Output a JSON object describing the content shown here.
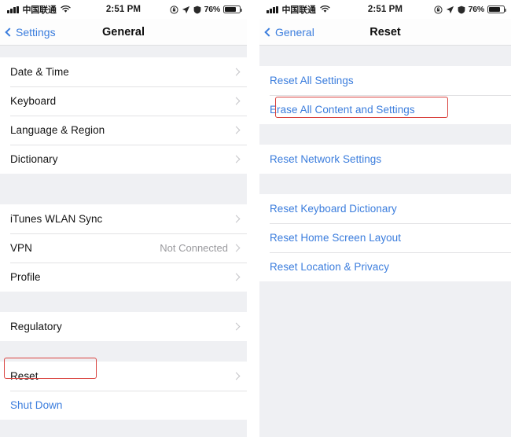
{
  "status_bar": {
    "carrier": "中国联通",
    "time": "2:51 PM",
    "battery_percent": "76%",
    "signal_icon": "cellular-bars-icon",
    "wifi_icon": "wifi-icon",
    "rotation_lock_icon": "rotation-lock-icon",
    "location_icon": "location-arrow-icon",
    "dnd_icon": "do-not-disturb-icon",
    "battery_icon": "battery-icon"
  },
  "left_screen": {
    "back_label": "Settings",
    "title": "General",
    "sections": [
      {
        "rows": [
          {
            "label": "Date & Time",
            "value": "",
            "chevron": true,
            "link": false
          },
          {
            "label": "Keyboard",
            "value": "",
            "chevron": true,
            "link": false
          },
          {
            "label": "Language & Region",
            "value": "",
            "chevron": true,
            "link": false
          },
          {
            "label": "Dictionary",
            "value": "",
            "chevron": true,
            "link": false
          }
        ]
      },
      {
        "rows": [
          {
            "label": "iTunes WLAN Sync",
            "value": "",
            "chevron": true,
            "link": false
          },
          {
            "label": "VPN",
            "value": "Not Connected",
            "chevron": true,
            "link": false
          },
          {
            "label": "Profile",
            "value": "",
            "chevron": true,
            "link": false
          }
        ]
      },
      {
        "rows": [
          {
            "label": "Regulatory",
            "value": "",
            "chevron": true,
            "link": false
          }
        ]
      },
      {
        "rows": [
          {
            "label": "Reset",
            "value": "",
            "chevron": true,
            "link": false
          },
          {
            "label": "Shut Down",
            "value": "",
            "chevron": false,
            "link": true
          }
        ]
      }
    ]
  },
  "right_screen": {
    "back_label": "General",
    "title": "Reset",
    "sections": [
      {
        "rows": [
          {
            "label": "Reset All Settings",
            "value": "",
            "chevron": false,
            "link": true
          },
          {
            "label": "Erase All Content and Settings",
            "value": "",
            "chevron": false,
            "link": true
          }
        ]
      },
      {
        "rows": [
          {
            "label": "Reset Network Settings",
            "value": "",
            "chevron": false,
            "link": true
          }
        ]
      },
      {
        "rows": [
          {
            "label": "Reset Keyboard Dictionary",
            "value": "",
            "chevron": false,
            "link": true
          },
          {
            "label": "Reset Home Screen Layout",
            "value": "",
            "chevron": false,
            "link": true
          },
          {
            "label": "Reset Location & Privacy",
            "value": "",
            "chevron": false,
            "link": true
          }
        ]
      }
    ]
  },
  "annotations": {
    "highlight_color": "#d9433f",
    "reset_box_target": "Reset",
    "erase_box_target": "Erase All Content and Settings"
  },
  "colors": {
    "link_blue": "#3b7ddd",
    "group_background": "#eff0f3",
    "row_background": "#ffffff",
    "separator": "#e2e2e4"
  }
}
